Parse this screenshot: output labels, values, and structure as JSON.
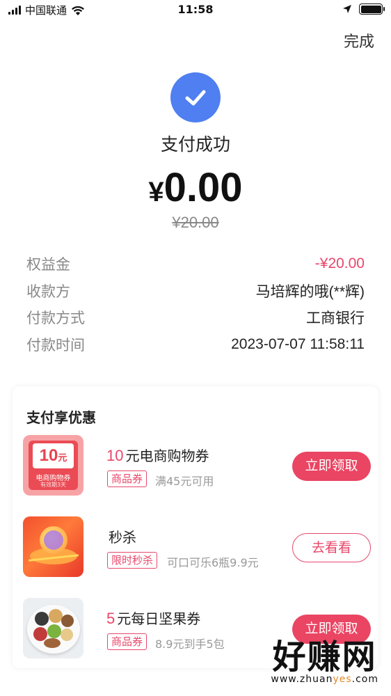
{
  "status_bar": {
    "carrier": "中国联通",
    "time": "11:58"
  },
  "header": {
    "done_label": "完成"
  },
  "payment": {
    "status": "支付成功",
    "currency": "¥",
    "amount": "0.00",
    "original_amount": "¥20.00"
  },
  "details": [
    {
      "label": "权益金",
      "value": "-¥20.00",
      "highlight": true
    },
    {
      "label": "收款方",
      "value": "马培辉的哦(**辉)",
      "highlight": false
    },
    {
      "label": "付款方式",
      "value": "工商银行",
      "highlight": false
    },
    {
      "label": "付款时间",
      "value": "2023-07-07 11:58:11",
      "highlight": false
    }
  ],
  "promo": {
    "title": "支付享优惠",
    "items": [
      {
        "title_accent": "10",
        "title_text": "元电商购物券",
        "tag": "商品券",
        "desc": "满45元可用",
        "cta": "立即领取",
        "thumb": {
          "amount": "10",
          "unit": "元",
          "label": "电商购物券",
          "sublabel": "有效期3天"
        }
      },
      {
        "title_accent": "",
        "title_text": "秒杀",
        "tag": "限时秒杀",
        "desc": "可口可乐6瓶9.9元",
        "cta": "去看看"
      },
      {
        "title_accent": "5",
        "title_text": "元每日坚果券",
        "tag": "商品券",
        "desc": "8.9元到手5包",
        "cta": "立即领取"
      }
    ]
  },
  "watermark": {
    "main": "好赚网",
    "url_pre": "www.zhuan",
    "url_hl": "yes",
    "url_post": ".com"
  },
  "colors": {
    "accent": "#e8476a",
    "success_blue": "#4f7ff0",
    "button_red": "#ea4563"
  }
}
